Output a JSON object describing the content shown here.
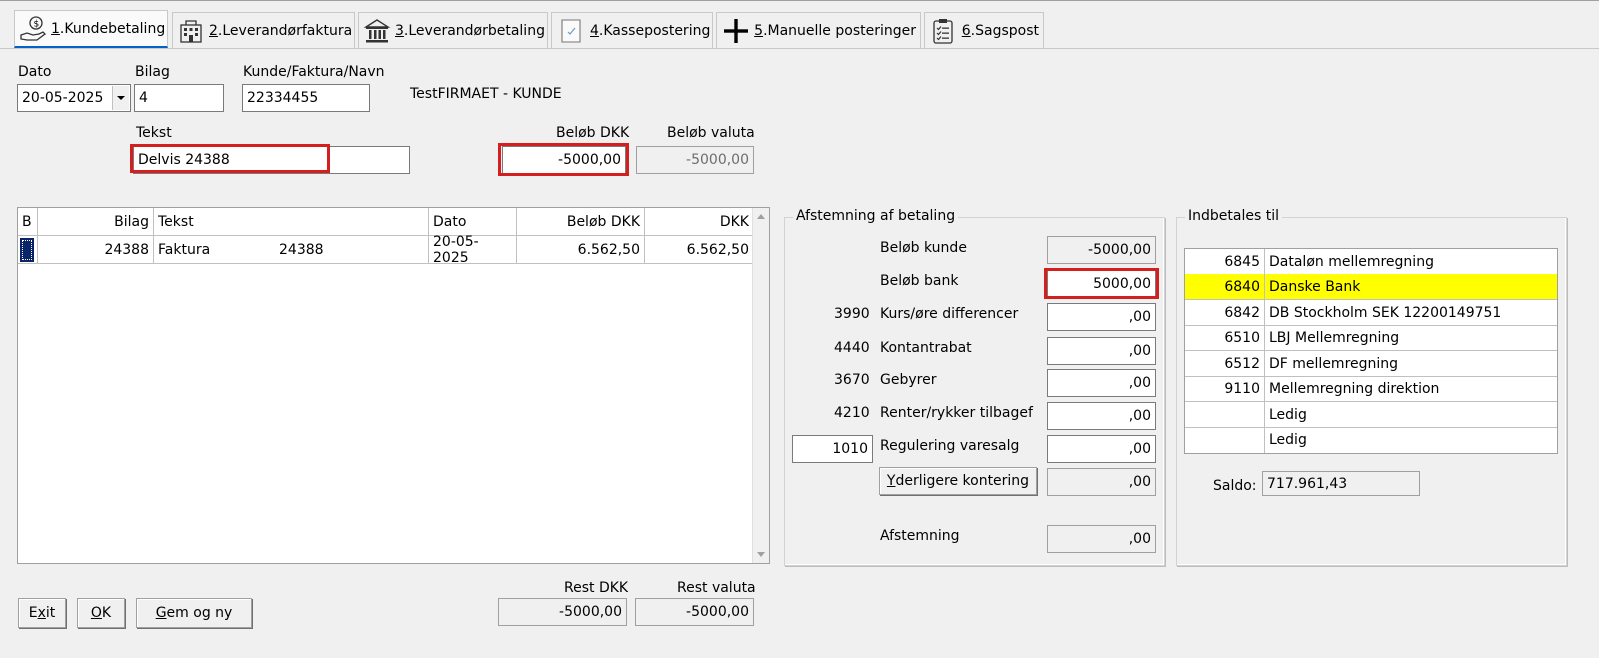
{
  "tabs": [
    {
      "num": "1",
      "label": ".Kundebetaling",
      "icon": "hand-money-icon"
    },
    {
      "num": "2",
      "label": ".Leverandørfaktura",
      "icon": "building-icon"
    },
    {
      "num": "3",
      "label": ".Leverandørbetaling",
      "icon": "bank-icon"
    },
    {
      "num": "4",
      "label": ".Kassepostering",
      "icon": "receipt-icon"
    },
    {
      "num": "5",
      "label": ".Manuelle posteringer",
      "icon": "plus-icon"
    },
    {
      "num": "6",
      "label": ".Sagspost",
      "icon": "checklist-icon"
    }
  ],
  "header": {
    "dato_label": "Dato",
    "dato_value": "20-05-2025",
    "bilag_label": "Bilag",
    "bilag_value": "4",
    "kunde_label": "Kunde/Faktura/Navn",
    "kunde_value": "22334455",
    "kunde_name": "TestFIRMAET - KUNDE",
    "tekst_label": "Tekst",
    "tekst_value": "Delvis 24388",
    "belob_dkk_label": "Beløb DKK",
    "belob_dkk_value": "-5000,00",
    "belob_valuta_label": "Beløb valuta",
    "belob_valuta_value": "-5000,00"
  },
  "grid": {
    "columns": [
      "B",
      "Bilag",
      "Tekst",
      "Dato",
      "Beløb DKK",
      "DKK"
    ],
    "rows": [
      {
        "b": "",
        "bilag": "24388",
        "tekst": "Faktura",
        "tekst2": "24388",
        "dato": "20-05-2025",
        "belob": "6.562,50",
        "dkk": "6.562,50"
      }
    ]
  },
  "afstemning": {
    "title": "Afstemning af betaling",
    "belob_kunde_label": "Beløb kunde",
    "belob_kunde_value": "-5000,00",
    "belob_bank_label": "Beløb bank",
    "belob_bank_value": "5000,00",
    "lines": [
      {
        "acct": "3990",
        "label": "Kurs/øre differencer",
        "value": ",00"
      },
      {
        "acct": "4440",
        "label": "Kontantrabat",
        "value": ",00"
      },
      {
        "acct": "3670",
        "label": "Gebyrer",
        "value": ",00"
      },
      {
        "acct": "4210",
        "label": "Renter/rykker tilbagef",
        "value": ",00"
      }
    ],
    "regulering_acct": "1010",
    "regulering_label": "Regulering varesalg",
    "regulering_value": ",00",
    "yderligere_label_u": "Y",
    "yderligere_label": "derligere kontering",
    "yderligere_value": ",00",
    "afstemning_label": "Afstemning",
    "afstemning_value": ",00"
  },
  "indbetales": {
    "title": "Indbetales til",
    "accounts": [
      {
        "num": "6845",
        "name": "Dataløn mellemregning"
      },
      {
        "num": "6840",
        "name": "Danske Bank"
      },
      {
        "num": "6842",
        "name": "DB Stockholm SEK 12200149751"
      },
      {
        "num": "6510",
        "name": "LBJ Mellemregning"
      },
      {
        "num": "6512",
        "name": "DF mellemregning"
      },
      {
        "num": "9110",
        "name": "Mellemregning direktion"
      },
      {
        "num": "",
        "name": "Ledig"
      },
      {
        "num": "",
        "name": "Ledig"
      }
    ],
    "saldo_label": "Saldo:",
    "saldo_value": "717.961,43"
  },
  "footer": {
    "exit_u": "x",
    "exit_pre": "E",
    "exit_post": "it",
    "ok_u": "O",
    "ok_post": "K",
    "gem_u": "G",
    "gem_post": "em og ny",
    "rest_dkk_label": "Rest DKK",
    "rest_dkk_value": "-5000,00",
    "rest_valuta_label": "Rest valuta",
    "rest_valuta_value": "-5000,00"
  },
  "colors": {
    "highlight": "#ffff00",
    "annotation": "#d41f1f",
    "selected_cell": "#0a246a"
  }
}
